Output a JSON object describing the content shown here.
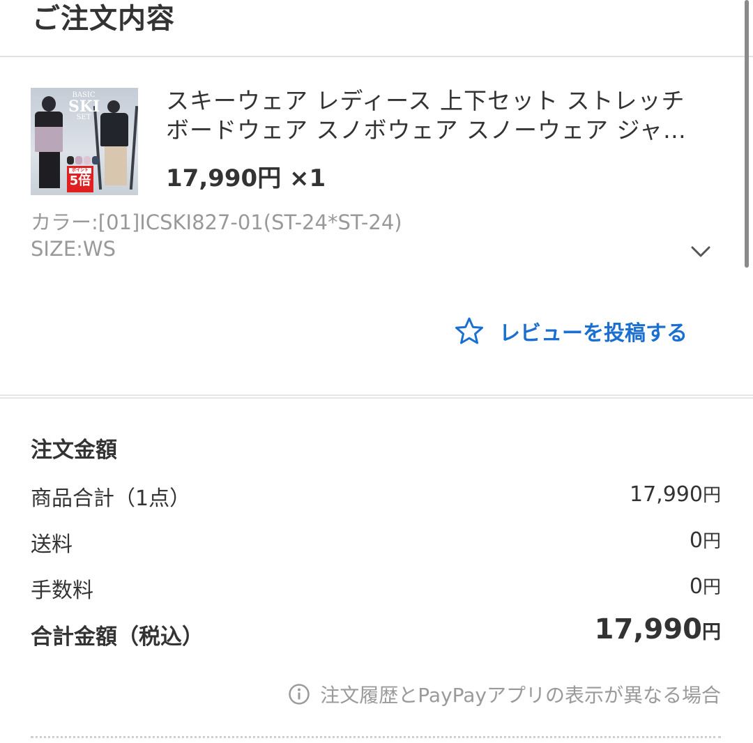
{
  "header": {
    "title": "ご注文内容"
  },
  "product": {
    "name_line1": "スキーウェア レディース 上下セット ストレッチ",
    "name_line2": "ボードウェア スノボウェア スノーウェア ジャ…",
    "price": "17,990円 ×1",
    "color_option": "カラー:[01]ICSKI827-01(ST-24*ST-24)",
    "size_option": "SIZE:WS",
    "thumbnail": {
      "text_basic": "BASIC",
      "text_ski": "SKI",
      "text_set": "SET",
      "badge_top": "ポイント",
      "badge_num": "5倍"
    }
  },
  "review": {
    "label": "レビューを投稿する",
    "icon": "star-icon",
    "color": "#1a6fd0"
  },
  "summary": {
    "title": "注文金額",
    "rows": [
      {
        "label": "商品合計（1点）",
        "amount": "17,990",
        "unit": "円"
      },
      {
        "label": "送料",
        "amount": "0",
        "unit": "円"
      },
      {
        "label": "手数料",
        "amount": "0",
        "unit": "円"
      }
    ],
    "total": {
      "label": "合計金額（税込）",
      "amount": "17,990",
      "unit": "円"
    }
  },
  "note": {
    "text": "注文履歴とPayPayアプリの表示が異なる場合",
    "icon": "info-icon"
  }
}
